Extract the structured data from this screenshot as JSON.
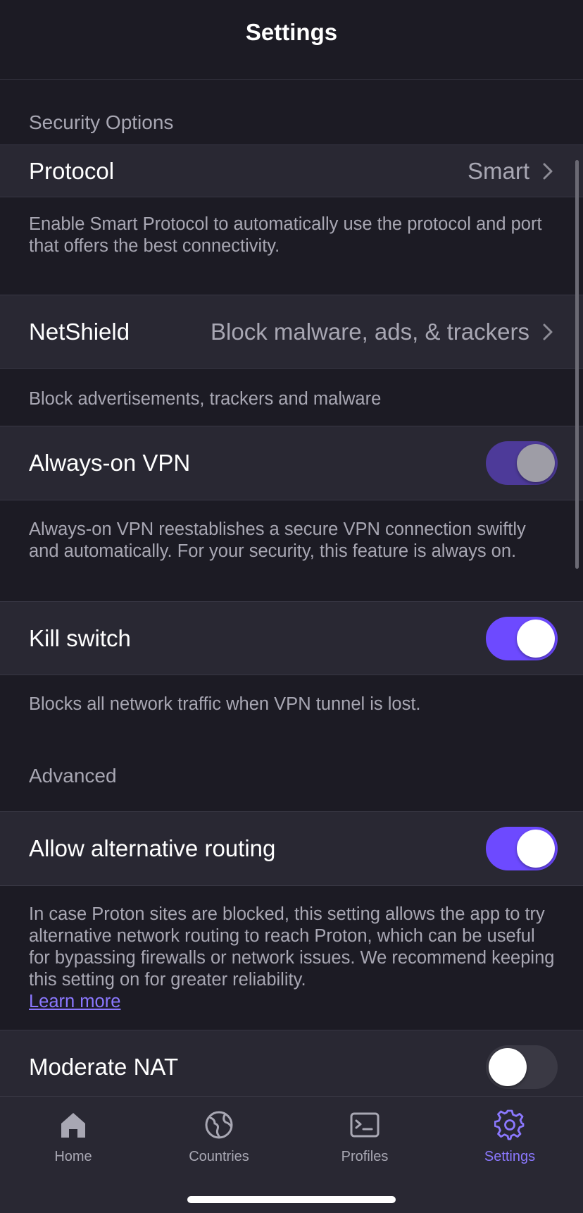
{
  "header": {
    "title": "Settings"
  },
  "sections": {
    "security": {
      "title": "Security Options",
      "protocol": {
        "label": "Protocol",
        "value": "Smart",
        "description": "Enable Smart Protocol to automatically use the protocol and port that offers the best connectivity."
      },
      "netshield": {
        "label": "NetShield",
        "value": "Block malware, ads, & trackers",
        "description": "Block advertisements, trackers and malware"
      },
      "always_on": {
        "label": "Always-on VPN",
        "state": "on (disabled)",
        "description": "Always-on VPN reestablishes a secure VPN connection swiftly and automatically. For your security, this feature is always on."
      },
      "kill_switch": {
        "label": "Kill switch",
        "state": "on",
        "description": "Blocks all network traffic when VPN tunnel is lost."
      }
    },
    "advanced": {
      "title": "Advanced",
      "alt_routing": {
        "label": "Allow alternative routing",
        "state": "on",
        "description": "In case Proton sites are blocked, this setting allows the app to try alternative network routing to reach Proton, which can be useful for bypassing firewalls or network issues. We recommend keeping this setting on for greater reliability.",
        "link": "Learn more"
      },
      "moderate_nat": {
        "label": "Moderate NAT",
        "state": "off"
      }
    }
  },
  "tabbar": {
    "tabs": [
      {
        "label": "Home",
        "icon": "home-icon",
        "active": false
      },
      {
        "label": "Countries",
        "icon": "globe-icon",
        "active": false
      },
      {
        "label": "Profiles",
        "icon": "terminal-icon",
        "active": false
      },
      {
        "label": "Settings",
        "icon": "gear-icon",
        "active": true
      }
    ]
  },
  "colors": {
    "background": "#1c1b24",
    "row": "#292833",
    "accent": "#6d4aff",
    "accent_text": "#8b78ff",
    "secondary_text": "#a8a7b3"
  }
}
